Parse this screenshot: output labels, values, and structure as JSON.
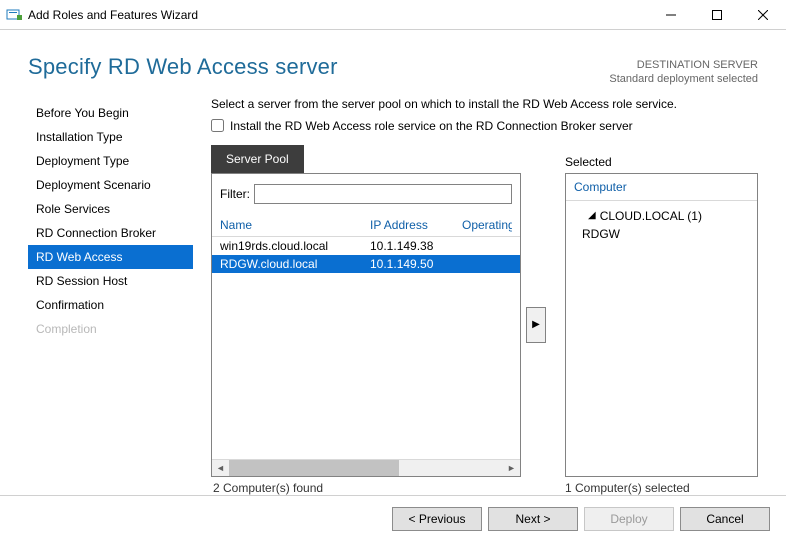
{
  "window": {
    "title": "Add Roles and Features Wizard"
  },
  "header": {
    "page_title": "Specify RD Web Access server",
    "dest_label": "DESTINATION SERVER",
    "dest_value": "Standard deployment selected"
  },
  "sidebar": {
    "items": [
      {
        "label": "Before You Begin",
        "active": false,
        "disabled": false
      },
      {
        "label": "Installation Type",
        "active": false,
        "disabled": false
      },
      {
        "label": "Deployment Type",
        "active": false,
        "disabled": false
      },
      {
        "label": "Deployment Scenario",
        "active": false,
        "disabled": false
      },
      {
        "label": "Role Services",
        "active": false,
        "disabled": false
      },
      {
        "label": "RD Connection Broker",
        "active": false,
        "disabled": false
      },
      {
        "label": "RD Web Access",
        "active": true,
        "disabled": false
      },
      {
        "label": "RD Session Host",
        "active": false,
        "disabled": false
      },
      {
        "label": "Confirmation",
        "active": false,
        "disabled": false
      },
      {
        "label": "Completion",
        "active": false,
        "disabled": true
      }
    ]
  },
  "content": {
    "instruction": "Select a server from the server pool on which to install the RD Web Access role service.",
    "checkbox_label": "Install the RD Web Access role service on the RD Connection Broker server",
    "checkbox_checked": false,
    "tab_label": "Server Pool",
    "filter_label": "Filter:",
    "filter_value": "",
    "columns": {
      "name": "Name",
      "ip": "IP Address",
      "os": "Operating"
    },
    "rows": [
      {
        "name": "win19rds.cloud.local",
        "ip": "10.1.149.38",
        "selected": false
      },
      {
        "name": "RDGW.cloud.local",
        "ip": "10.1.149.50",
        "selected": true
      }
    ],
    "found_count": "2 Computer(s) found",
    "selected_header": "Selected",
    "selected_col": "Computer",
    "selected_group": "CLOUD.LOCAL (1)",
    "selected_items": [
      "RDGW"
    ],
    "selected_count": "1 Computer(s) selected"
  },
  "footer": {
    "previous": "< Previous",
    "next": "Next >",
    "deploy": "Deploy",
    "cancel": "Cancel"
  }
}
